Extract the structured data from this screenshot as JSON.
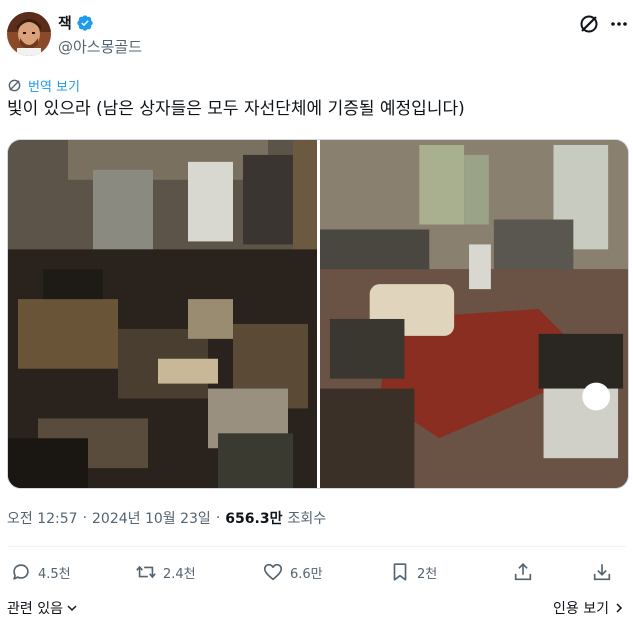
{
  "author": {
    "display_name": "잭",
    "handle": "@아스몽골드",
    "verified": true,
    "avatar_icon": "avatar-photo"
  },
  "header": {
    "grok_icon": "slashed-circle-icon",
    "more_icon": "more-dots-icon"
  },
  "translate": {
    "label": "번역 보기",
    "icon": "translate-icon"
  },
  "post": {
    "text": "빛이 있으라 (남은 상자들은 모두 자선단체에 기증될 예정입니다)",
    "images": [
      {
        "name": "photo-before"
      },
      {
        "name": "photo-after"
      }
    ]
  },
  "meta": {
    "time": "오전 12:57",
    "separator": "·",
    "date": "2024년 10월 23일",
    "separator2": "·",
    "views_count": "656.3만",
    "views_label": "조회수"
  },
  "actions": {
    "reply": {
      "count": "4.5천",
      "icon": "reply-bubble-icon"
    },
    "retweet": {
      "count": "2.4천",
      "icon": "retweet-icon"
    },
    "like": {
      "count": "6.6만",
      "icon": "heart-icon"
    },
    "bookmark": {
      "count": "2천",
      "icon": "bookmark-icon"
    },
    "share": {
      "icon": "share-upload-icon"
    },
    "download": {
      "icon": "download-icon"
    }
  },
  "footer": {
    "related": "관련 있음",
    "quote": "인용 보기"
  },
  "colors": {
    "accent": "#1d9bf0",
    "text": "#0f1419",
    "secondary": "#536471",
    "divider": "#eff3f4"
  }
}
